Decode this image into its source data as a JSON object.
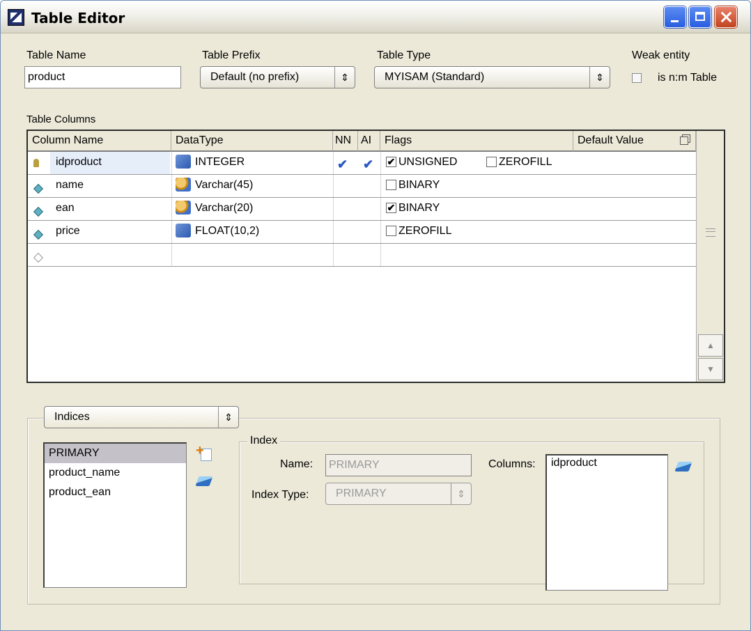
{
  "window": {
    "title": "Table Editor"
  },
  "table": {
    "name_label": "Table Name",
    "name_value": "product",
    "prefix_label": "Table Prefix",
    "prefix_value": "Default  (no prefix)",
    "type_label": "Table Type",
    "type_value": "MYISAM  (Standard)",
    "weak_label": "Weak entity",
    "nm_label": "is n:m Table"
  },
  "columns_section": {
    "label": "Table Columns",
    "headers": [
      "Column Name",
      "DataType",
      "NN",
      "AI",
      "Flags",
      "Default Value"
    ],
    "rows": [
      {
        "icon": "primary-key-icon",
        "name": "idproduct",
        "type_icon": "numeric-type-icon",
        "type": "INTEGER",
        "nn": "✔",
        "ai": "✔",
        "flags": [
          {
            "label": "UNSIGNED",
            "checked": true
          },
          {
            "label": "ZEROFILL",
            "checked": false
          }
        ]
      },
      {
        "icon": "column-diamond-icon",
        "name": "name",
        "type_icon": "string-type-icon",
        "type": "Varchar(45)",
        "nn": "",
        "ai": "",
        "flags": [
          {
            "label": "BINARY",
            "checked": false
          }
        ]
      },
      {
        "icon": "column-diamond-icon",
        "name": "ean",
        "type_icon": "string-type-icon",
        "type": "Varchar(20)",
        "nn": "",
        "ai": "",
        "flags": [
          {
            "label": "BINARY",
            "checked": true
          }
        ]
      },
      {
        "icon": "column-diamond-icon",
        "name": "price",
        "type_icon": "numeric-type-icon",
        "type": "FLOAT(10,2)",
        "nn": "",
        "ai": "",
        "flags": [
          {
            "label": "ZEROFILL",
            "checked": false
          }
        ]
      }
    ]
  },
  "indices": {
    "dropdown_value": "Indices",
    "list": [
      "PRIMARY",
      "product_name",
      "product_ean"
    ],
    "selected": "PRIMARY",
    "index_group_label": "Index",
    "name_label": "Name:",
    "name_value": "PRIMARY",
    "type_label": "Index Type:",
    "type_value": "PRIMARY",
    "columns_label": "Columns:",
    "columns": [
      "idproduct"
    ]
  },
  "marks": {
    "check": "✔",
    "arrows": "⇕"
  }
}
